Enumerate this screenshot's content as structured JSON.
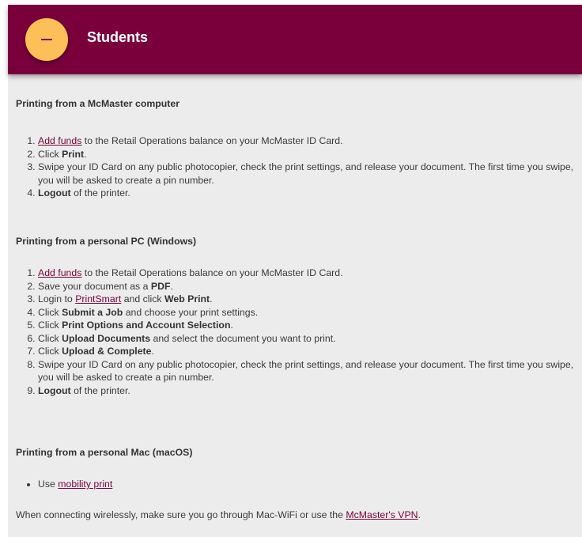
{
  "header": {
    "title": "Students",
    "toggle_icon": "minus-icon"
  },
  "colors": {
    "maroon": "#7a003c",
    "gold": "#fdbf57",
    "panel": "#ececec"
  },
  "section1": {
    "heading": "Printing from a McMaster computer",
    "step1": {
      "link": "Add funds",
      "rest": " to the Retail Operations balance on your McMaster ID Card."
    },
    "step2": {
      "pre": "Click ",
      "bold": "Print",
      "post": "."
    },
    "step3": {
      "text": "Swipe your ID Card on any public photocopier, check the print settings, and release your document. The first time you swipe, you will be asked to create a pin number."
    },
    "step4": {
      "bold": "Logout",
      "post": " of the printer."
    }
  },
  "section2": {
    "heading": "Printing from a personal PC (Windows)",
    "step1": {
      "link": "Add funds",
      "rest": " to the Retail Operations balance on your McMaster ID Card."
    },
    "step2": {
      "pre": "Save your document as a ",
      "bold": "PDF",
      "post": "."
    },
    "step3": {
      "pre": "Login to ",
      "link": "PrintSmart",
      "mid": " and click ",
      "bold": "Web Print",
      "post": "."
    },
    "step4": {
      "pre": "Click ",
      "bold": "Submit a Job",
      "post": " and choose your print settings."
    },
    "step5": {
      "pre": "Click ",
      "bold": "Print Options and Account Selection",
      "post": "."
    },
    "step6": {
      "pre": "Click ",
      "bold": "Upload Documents",
      "post": " and select the document you want to print."
    },
    "step7": {
      "pre": "Click ",
      "bold": "Upload & Complete",
      "post": "."
    },
    "step8": {
      "text": "Swipe your ID Card on any public photocopier, check the print settings, and release your document. The first time you swipe, you will be asked to create a pin number."
    },
    "step9": {
      "bold": "Logout",
      "post": " of the printer."
    }
  },
  "section3": {
    "heading": "Printing from a personal Mac (macOS)",
    "item1": {
      "pre": "Use ",
      "link": "mobility print"
    }
  },
  "note": {
    "pre": "When connecting wirelessly, make sure you go through Mac-WiFi or use the ",
    "link": "McMaster's VPN",
    "post": "."
  }
}
